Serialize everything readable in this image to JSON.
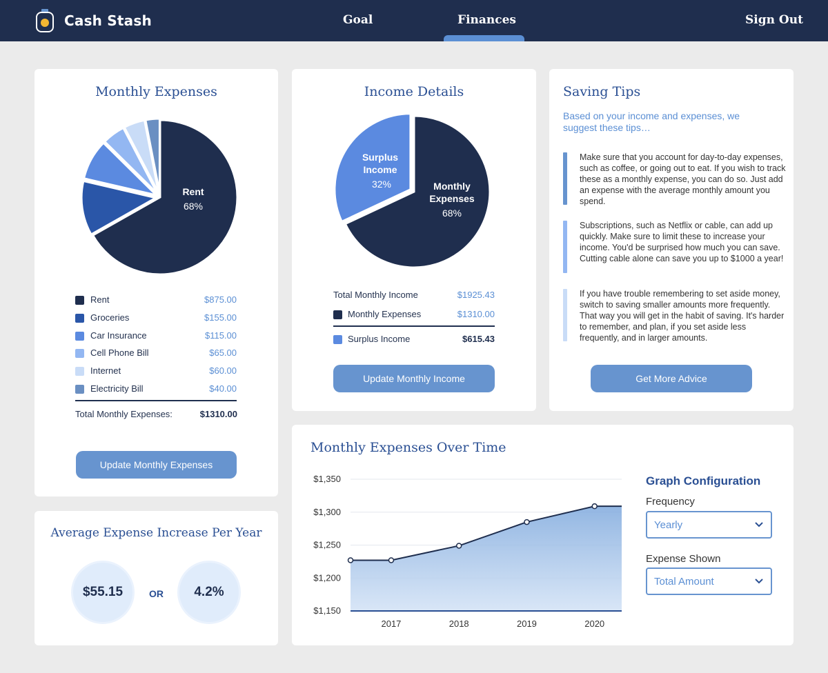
{
  "header": {
    "app_title": "Cash Stash",
    "nav": {
      "goal": "Goal",
      "finances": "Finances",
      "sign_out": "Sign Out"
    },
    "active_nav": "Finances"
  },
  "monthly_expenses": {
    "title": "Monthly Expenses",
    "slice_label": "Rent",
    "slice_pct": "68%",
    "items": [
      {
        "label": "Rent",
        "value": "$875.00",
        "color": "#1f2e4e"
      },
      {
        "label": "Groceries",
        "value": "$155.00",
        "color": "#2a56a8"
      },
      {
        "label": "Car Insurance",
        "value": "$115.00",
        "color": "#5b8ae0"
      },
      {
        "label": "Cell Phone Bill",
        "value": "$65.00",
        "color": "#93b7f2"
      },
      {
        "label": "Internet",
        "value": "$60.00",
        "color": "#c9dcf7"
      },
      {
        "label": "Electricity Bill",
        "value": "$40.00",
        "color": "#6a8fc2"
      }
    ],
    "total_label": "Total Monthly Expenses:",
    "total_value": "$1310.00",
    "button": "Update Monthly Expenses"
  },
  "income_details": {
    "title": "Income Details",
    "surplus_label_1": "Surplus",
    "surplus_label_2": "Income",
    "surplus_pct": "32%",
    "expenses_label_1": "Monthly",
    "expenses_label_2": "Expenses",
    "expenses_pct": "68%",
    "total_income_label": "Total Monthly Income",
    "total_income_value": "$1925.43",
    "monthly_expenses_label": "Monthly Expenses",
    "monthly_expenses_value": "$1310.00",
    "surplus_label": "Surplus Income",
    "surplus_value": "$615.43",
    "button": "Update Monthly Income",
    "colors": {
      "expenses": "#1f2e4e",
      "surplus": "#5b8ae0"
    }
  },
  "saving_tips": {
    "title": "Saving Tips",
    "intro": "Based on your income and expenses, we suggest these tips…",
    "tips": [
      {
        "text": "Make sure that you account for day-to-day expenses, such as coffee, or going out to eat. If you wish to track these as a monthly expense, you can do so. Just add an expense with the average monthly amount you spend.",
        "color": "#6794cf"
      },
      {
        "text": "Subscriptions, such as Netflix or cable, can add up quickly. Make sure to limit these to increase your income. You'd be surprised how much you can save. Cutting cable alone can save you up to $1000 a year!",
        "color": "#93b7f2"
      },
      {
        "text": "If you have trouble remembering to set aside money, switch to saving smaller amounts more frequently. That way you will get in the habit of saving. It's harder to remember, and plan, if you set aside less frequently, and in larger amounts.",
        "color": "#c9dcf7"
      }
    ],
    "button": "Get More Advice"
  },
  "avg_increase": {
    "title": "Average Expense Increase Per Year",
    "amount": "$55.15",
    "or": "OR",
    "percent": "4.2%"
  },
  "expenses_over_time": {
    "title": "Monthly Expenses Over Time",
    "config_title": "Graph Configuration",
    "frequency_label": "Frequency",
    "frequency_value": "Yearly",
    "expense_shown_label": "Expense Shown",
    "expense_shown_value": "Total Amount"
  },
  "chart_data": {
    "type": "area",
    "title": "Monthly Expenses Over Time",
    "xlabel": "",
    "ylabel": "",
    "x_ticks": [
      "2017",
      "2018",
      "2019",
      "2020"
    ],
    "y_ticks": [
      "$1,350",
      "$1,300",
      "$1,250",
      "$1,200",
      "$1,150"
    ],
    "ylim": [
      1150,
      1350
    ],
    "x": [
      2016.4,
      2017,
      2018,
      2019,
      2020,
      2020.4
    ],
    "values": [
      1227,
      1227,
      1249,
      1285,
      1309,
      1309
    ],
    "grid": true,
    "color": "#5b8fd4"
  }
}
